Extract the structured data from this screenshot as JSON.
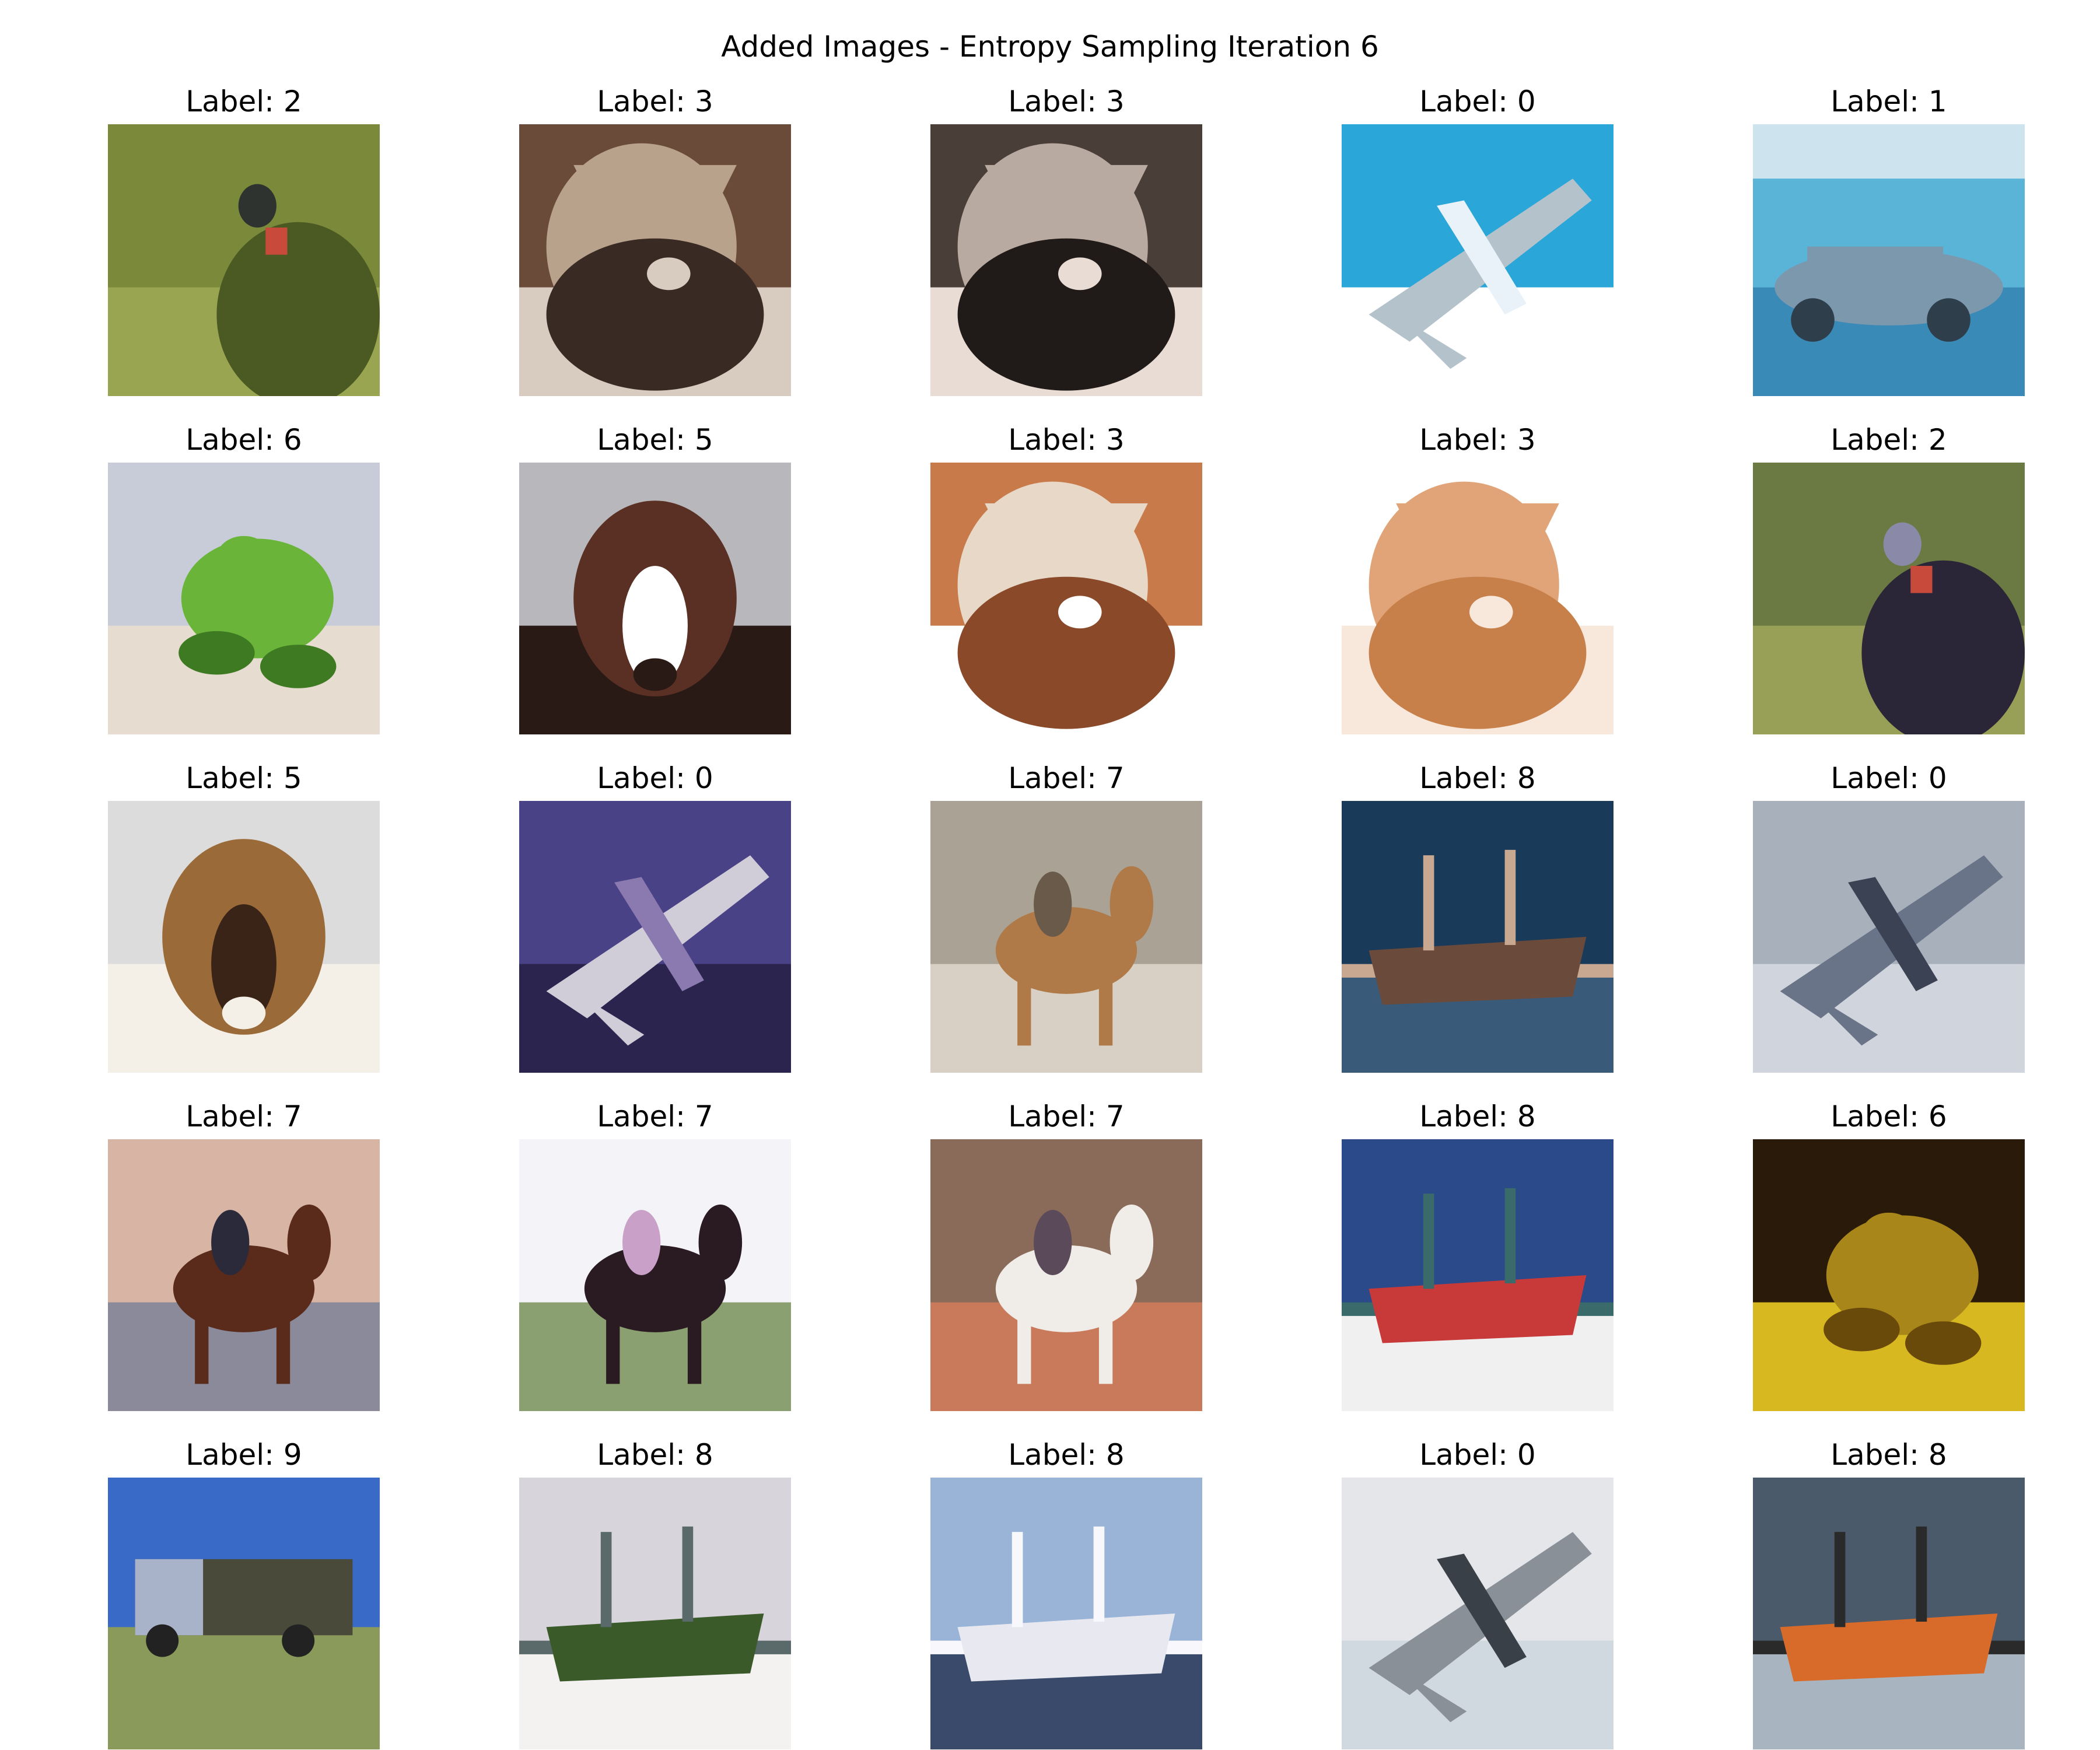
{
  "figure": {
    "title": "Added Images - Entropy Sampling Iteration 6"
  },
  "grid": {
    "rows": 5,
    "cols": 5,
    "cells": [
      {
        "label": "Label: 2",
        "subject": "bird",
        "palette": [
          "#7a8a3a",
          "#4a5a22",
          "#2e3330",
          "#9aa552"
        ]
      },
      {
        "label": "Label: 3",
        "subject": "cat",
        "palette": [
          "#6a4a38",
          "#b9a28c",
          "#3a2a24",
          "#d8ccc0"
        ]
      },
      {
        "label": "Label: 3",
        "subject": "cat",
        "palette": [
          "#4a3e38",
          "#b8aaa0",
          "#201a18",
          "#e8dcd4"
        ]
      },
      {
        "label": "Label: 0",
        "subject": "airplane",
        "palette": [
          "#2aa6d8",
          "#e8f2f8",
          "#b4c2cc",
          "#ffffff"
        ]
      },
      {
        "label": "Label: 1",
        "subject": "automobile",
        "palette": [
          "#5ab4d8",
          "#7c98ac",
          "#2e3e4a",
          "#cde4ef"
        ]
      },
      {
        "label": "Label: 6",
        "subject": "frog",
        "palette": [
          "#c8ccd8",
          "#6ab43a",
          "#3e7a22",
          "#e6dcd0"
        ]
      },
      {
        "label": "Label: 5",
        "subject": "dog",
        "palette": [
          "#b8b8bc",
          "#5a3024",
          "#ffffff",
          "#2a1a16"
        ]
      },
      {
        "label": "Label: 3",
        "subject": "cat",
        "palette": [
          "#c87a4a",
          "#e8d8c8",
          "#8a4a2a",
          "#ffffff"
        ]
      },
      {
        "label": "Label: 3",
        "subject": "cat",
        "palette": [
          "#ffffff",
          "#e0a478",
          "#c8804a",
          "#f8e8dc"
        ]
      },
      {
        "label": "Label: 2",
        "subject": "bird",
        "palette": [
          "#6a7a42",
          "#2a2638",
          "#8a8aa8",
          "#98a058"
        ]
      },
      {
        "label": "Label: 5",
        "subject": "dog",
        "palette": [
          "#dcdcdc",
          "#9a6a38",
          "#3a2418",
          "#f4f0e8"
        ]
      },
      {
        "label": "Label: 0",
        "subject": "airplane",
        "palette": [
          "#4a4286",
          "#8a7ab0",
          "#d0ccd8",
          "#2a244e"
        ]
      },
      {
        "label": "Label: 7",
        "subject": "horse",
        "palette": [
          "#aaa294",
          "#b07a48",
          "#6a5a4a",
          "#d8d0c4"
        ]
      },
      {
        "label": "Label: 8",
        "subject": "ship",
        "palette": [
          "#1a3a5a",
          "#6a4a3a",
          "#3a5a7a",
          "#c8a890"
        ]
      },
      {
        "label": "Label: 0",
        "subject": "airplane",
        "palette": [
          "#a8b0bc",
          "#3a4254",
          "#6a7488",
          "#d0d4dc"
        ]
      },
      {
        "label": "Label: 7",
        "subject": "horse",
        "palette": [
          "#d8b4a4",
          "#5a2a1a",
          "#2a2a3a",
          "#8a8a9a"
        ]
      },
      {
        "label": "Label: 7",
        "subject": "horse",
        "palette": [
          "#f4f4f8",
          "#2a1a22",
          "#c8a0c8",
          "#8aa070"
        ]
      },
      {
        "label": "Label: 7",
        "subject": "horse",
        "palette": [
          "#8a6a58",
          "#f0ece8",
          "#5a4a5a",
          "#c87a5a"
        ]
      },
      {
        "label": "Label: 8",
        "subject": "ship",
        "palette": [
          "#2a4a8a",
          "#c83a3a",
          "#f0f0f0",
          "#3a6a6a"
        ]
      },
      {
        "label": "Label: 6",
        "subject": "frog",
        "palette": [
          "#2a1a0a",
          "#a8861a",
          "#6a4a0a",
          "#d8b820"
        ]
      },
      {
        "label": "Label: 9",
        "subject": "truck",
        "palette": [
          "#3a6ac8",
          "#8a9a5a",
          "#4a4a3a",
          "#a8b2c8"
        ]
      },
      {
        "label": "Label: 8",
        "subject": "ship",
        "palette": [
          "#d8d4dc",
          "#3a5a2a",
          "#f4f2f0",
          "#5a6a6a"
        ]
      },
      {
        "label": "Label: 8",
        "subject": "ship",
        "palette": [
          "#9ab4d8",
          "#e8e8f0",
          "#3a4a6a",
          "#f8f8fc"
        ]
      },
      {
        "label": "Label: 0",
        "subject": "airplane",
        "palette": [
          "#e4e6ea",
          "#3a4048",
          "#8a9098",
          "#d0d8e0"
        ]
      },
      {
        "label": "Label: 8",
        "subject": "ship",
        "palette": [
          "#4a5a6a",
          "#d86a2a",
          "#a8b4c0",
          "#2a2a2a"
        ]
      }
    ]
  }
}
